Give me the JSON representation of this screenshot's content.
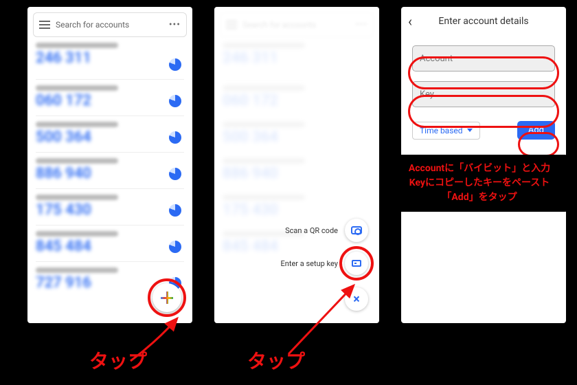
{
  "search_placeholder": "Search for accounts",
  "codes": [
    {
      "code": "246 311"
    },
    {
      "code": "060 172"
    },
    {
      "code": "500 364"
    },
    {
      "code": "886 940"
    },
    {
      "code": "175 430"
    },
    {
      "code": "845 484"
    },
    {
      "code": "727 916"
    }
  ],
  "menu": {
    "scan": "Scan a QR code",
    "key": "Enter a setup key"
  },
  "details": {
    "title": "Enter account details",
    "account": "Account",
    "key": "Key",
    "time_based": "Time based",
    "add": "Add"
  },
  "ann": {
    "tap": "タップ",
    "instr1": "Accountに「バイビット」と入力",
    "instr2": "Keyにコピーしたキーをペースト",
    "instr3": "「Add」をタップ"
  }
}
